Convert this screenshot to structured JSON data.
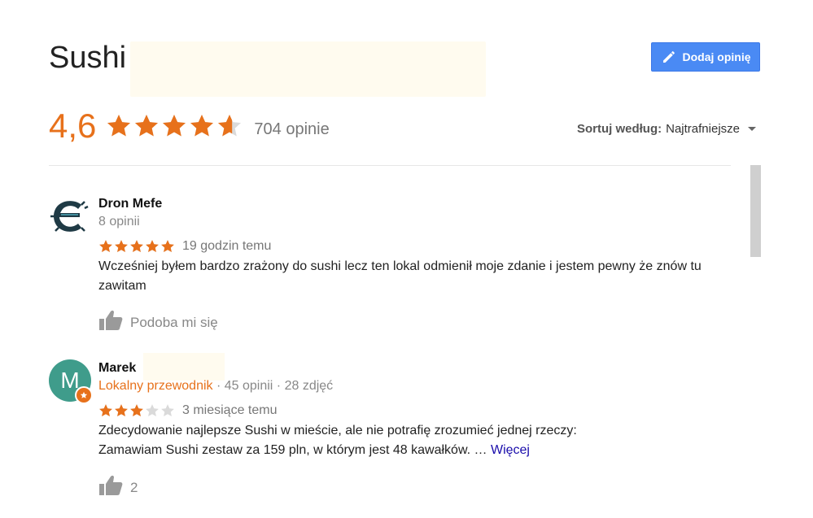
{
  "place": {
    "title": "Sushi"
  },
  "actions": {
    "add_review_label": "Dodaj opinię"
  },
  "summary": {
    "rating": "4,6",
    "rating_value": 4.6,
    "max_rating": 5,
    "review_count_label": "704 opinie"
  },
  "sort": {
    "label": "Sortuj według:",
    "selected": "Najtrafniejsze"
  },
  "colors": {
    "star_filled": "#e7711b",
    "star_empty": "#dadada",
    "accent_button": "#4a8af4",
    "link": "#1a0dab"
  },
  "reviews": [
    {
      "author": "Dron Mefe",
      "meta": "8 opinii",
      "avatar_icon": "stylized-e-logo-icon",
      "rating": 5,
      "time": "19 godzin temu",
      "text": "Wcześniej byłem bardzo zrażony do sushi lecz ten lokal odmienił moje zdanie i jestem pewny że znów tu zawitam",
      "like_label": "Podoba mi się"
    },
    {
      "author": "Marek",
      "avatar_letter": "M",
      "guide_label": "Lokalny przewodnik",
      "meta": " · 45 opinii · 28 zdjęć",
      "rating": 3,
      "time": "3 miesiące temu",
      "text_line1": "Zdecydowanie najlepsze Sushi w mieście, ale nie potrafię zrozumieć jednej rzeczy:",
      "text_line2": "Zamawiam Sushi zestaw za 159 pln,  w którym jest 48 kawałków. …",
      "more_label": "Więcej",
      "like_label": "2"
    }
  ]
}
